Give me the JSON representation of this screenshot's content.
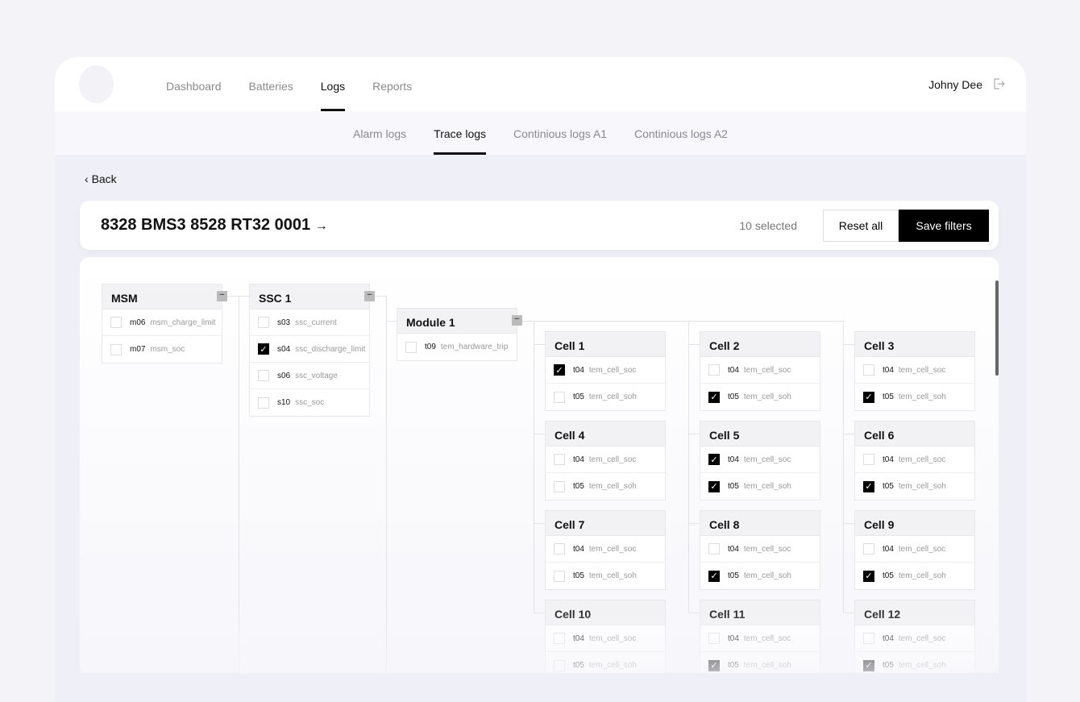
{
  "nav": {
    "items": [
      "Dashboard",
      "Batteries",
      "Logs",
      "Reports"
    ],
    "active": 2,
    "user": "Johny Dee"
  },
  "subnav": {
    "items": [
      "Alarm logs",
      "Trace logs",
      "Continious logs A1",
      "Continious logs A2"
    ],
    "active": 1
  },
  "back": "Back",
  "title": "8328 BMS3 8528 RT32 0001",
  "title_arrow": "→",
  "selected": "10 selected",
  "reset": "Reset all",
  "save": "Save filters",
  "groups": [
    {
      "name": "MSM",
      "rows": [
        {
          "code": "m06",
          "label": "msm_charge_limit",
          "checked": false
        },
        {
          "code": "m07",
          "label": "msm_soc",
          "checked": false
        }
      ]
    },
    {
      "name": "SSC 1",
      "rows": [
        {
          "code": "s03",
          "label": "ssc_current",
          "checked": false
        },
        {
          "code": "s04",
          "label": "ssc_discharge_limit",
          "checked": true
        },
        {
          "code": "s06",
          "label": "ssc_voltage",
          "checked": false
        },
        {
          "code": "s10",
          "label": "ssc_soc",
          "checked": false
        }
      ]
    },
    {
      "name": "Module 1",
      "rows": [
        {
          "code": "t09",
          "label": "tem_hardware_trip",
          "checked": false
        }
      ]
    }
  ],
  "cells": [
    {
      "name": "Cell 1",
      "rows": [
        {
          "code": "t04",
          "label": "tem_cell_soc",
          "checked": true
        },
        {
          "code": "t05",
          "label": "tem_cell_soh",
          "checked": false
        }
      ]
    },
    {
      "name": "Cell 2",
      "rows": [
        {
          "code": "t04",
          "label": "tem_cell_soc",
          "checked": false
        },
        {
          "code": "t05",
          "label": "tem_cell_soh",
          "checked": true
        }
      ]
    },
    {
      "name": "Cell 3",
      "rows": [
        {
          "code": "t04",
          "label": "tem_cell_soc",
          "checked": false
        },
        {
          "code": "t05",
          "label": "tem_cell_soh",
          "checked": true
        }
      ]
    },
    {
      "name": "Cell 4",
      "rows": [
        {
          "code": "t04",
          "label": "tem_cell_soc",
          "checked": false
        },
        {
          "code": "t05",
          "label": "tem_cell_soh",
          "checked": false
        }
      ]
    },
    {
      "name": "Cell 5",
      "rows": [
        {
          "code": "t04",
          "label": "tem_cell_soc",
          "checked": true
        },
        {
          "code": "t05",
          "label": "tem_cell_soh",
          "checked": true
        }
      ]
    },
    {
      "name": "Cell 6",
      "rows": [
        {
          "code": "t04",
          "label": "tem_cell_soc",
          "checked": false
        },
        {
          "code": "t05",
          "label": "tem_cell_soh",
          "checked": true
        }
      ]
    },
    {
      "name": "Cell 7",
      "rows": [
        {
          "code": "t04",
          "label": "tem_cell_soc",
          "checked": false
        },
        {
          "code": "t05",
          "label": "tem_cell_soh",
          "checked": false
        }
      ]
    },
    {
      "name": "Cell 8",
      "rows": [
        {
          "code": "t04",
          "label": "tem_cell_soc",
          "checked": false
        },
        {
          "code": "t05",
          "label": "tem_cell_soh",
          "checked": true
        }
      ]
    },
    {
      "name": "Cell 9",
      "rows": [
        {
          "code": "t04",
          "label": "tem_cell_soc",
          "checked": false
        },
        {
          "code": "t05",
          "label": "tem_cell_soh",
          "checked": true
        }
      ]
    },
    {
      "name": "Cell 10",
      "rows": [
        {
          "code": "t04",
          "label": "tem_cell_soc",
          "checked": false
        },
        {
          "code": "t05",
          "label": "tem_cell_soh",
          "checked": false
        }
      ]
    },
    {
      "name": "Cell 11",
      "rows": [
        {
          "code": "t04",
          "label": "tem_cell_soc",
          "checked": false
        },
        {
          "code": "t05",
          "label": "tem_cell_soh",
          "checked": true
        }
      ]
    },
    {
      "name": "Cell 12",
      "rows": [
        {
          "code": "t04",
          "label": "tem_cell_soc",
          "checked": false
        },
        {
          "code": "t05",
          "label": "tem_cell_soh",
          "checked": true
        }
      ]
    }
  ]
}
